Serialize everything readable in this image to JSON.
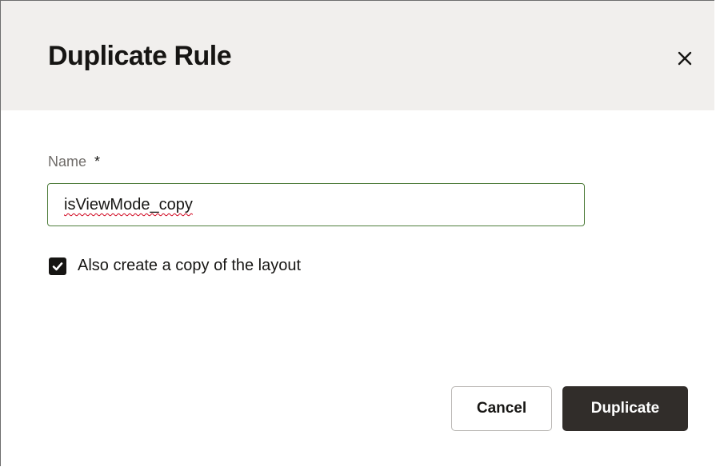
{
  "dialog": {
    "title": "Duplicate Rule",
    "close_icon": "close-icon"
  },
  "form": {
    "name_label": "Name",
    "required_marker": "*",
    "name_value": "isViewMode_copy",
    "copy_layout_label": "Also create a copy of the layout",
    "copy_layout_checked": true
  },
  "actions": {
    "cancel_label": "Cancel",
    "duplicate_label": "Duplicate"
  },
  "colors": {
    "header_bg": "#f1efed",
    "primary_button": "#312d2a",
    "input_border_focus": "#4f7d3c"
  }
}
